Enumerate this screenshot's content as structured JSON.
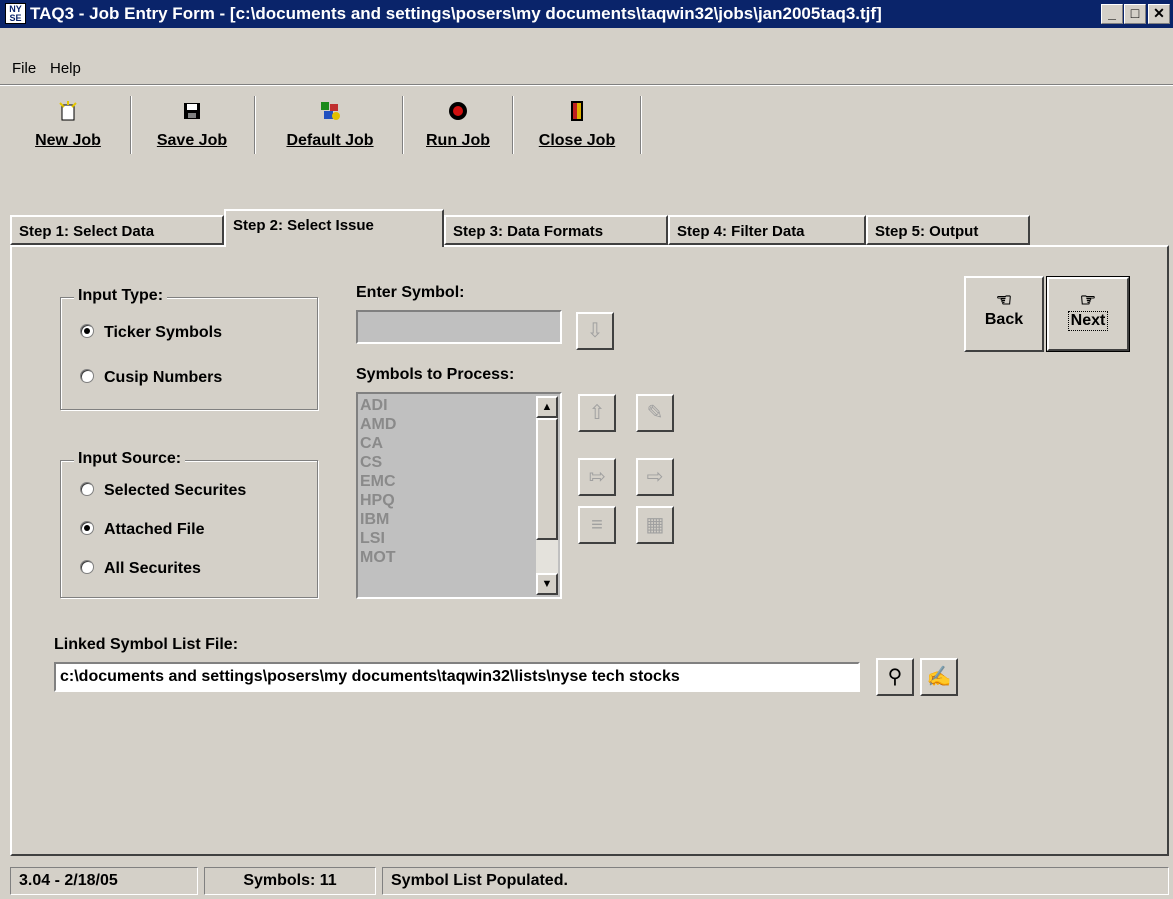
{
  "window": {
    "title": "TAQ3 - Job Entry Form - [c:\\documents and settings\\posers\\my documents\\taqwin32\\jobs\\jan2005taq3.tjf]",
    "logo_text": "NY SE"
  },
  "menu": {
    "file": "File",
    "help": "Help"
  },
  "toolbar": {
    "new_job": "New Job",
    "save_job": "Save Job",
    "default_job": "Default Job",
    "run_job": "Run Job",
    "close_job": "Close Job"
  },
  "tabs": [
    {
      "label": "Step 1: Select Data"
    },
    {
      "label": "Step 2: Select Issue"
    },
    {
      "label": "Step 3: Data Formats"
    },
    {
      "label": "Step 4: Filter Data"
    },
    {
      "label": "Step 5: Output"
    }
  ],
  "input_type": {
    "title": "Input Type:",
    "options": [
      "Ticker Symbols",
      "Cusip Numbers"
    ],
    "selected": "Ticker Symbols"
  },
  "input_source": {
    "title": "Input Source:",
    "options": [
      "Selected Securites",
      "Attached File",
      "All Securites"
    ],
    "selected": "Attached File"
  },
  "enter_symbol": {
    "label": "Enter Symbol:",
    "value": ""
  },
  "symbols_to_process": {
    "label": "Symbols to Process:",
    "items": [
      "ADI",
      "AMD",
      "CA",
      "CS",
      "EMC",
      "HPQ",
      "IBM",
      "LSI",
      "MOT"
    ]
  },
  "linked_file": {
    "label": "Linked Symbol List File:",
    "value": "c:\\documents and settings\\posers\\my documents\\taqwin32\\lists\\nyse tech stocks"
  },
  "nav": {
    "back": "Back",
    "next": "Next"
  },
  "status": {
    "version": "3.04 - 2/18/05",
    "symbols": "Symbols: 11",
    "message": "Symbol List Populated."
  },
  "colors": {
    "titlebar": "#0a246a",
    "face": "#d4d0c8"
  }
}
